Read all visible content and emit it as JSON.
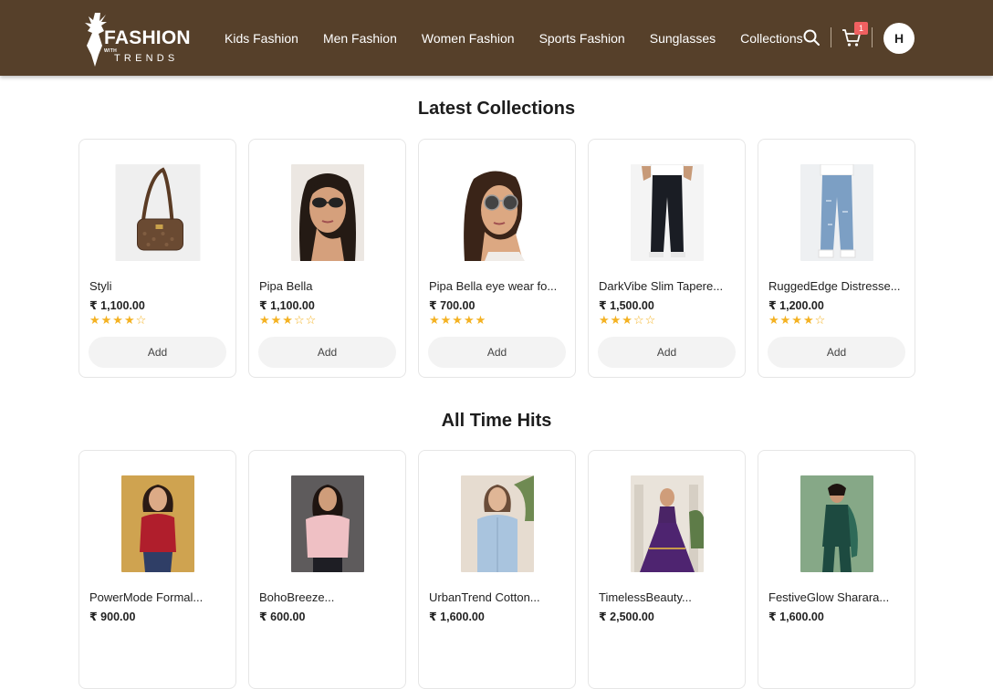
{
  "header": {
    "logo": {
      "title": "FASHION",
      "with": "WITH",
      "subtitle": "TRENDS"
    },
    "nav": [
      {
        "label": "Kids Fashion"
      },
      {
        "label": "Men Fashion"
      },
      {
        "label": "Women Fashion"
      },
      {
        "label": "Sports Fashion"
      },
      {
        "label": "Sunglasses"
      },
      {
        "label": "Collections"
      }
    ],
    "search_icon": "search-icon",
    "cart_icon": "cart-icon",
    "cart_count": "1",
    "avatar_initial": "H",
    "colors": {
      "header_bg": "#56402a",
      "badge": "#f06060",
      "star": "#f4b223"
    }
  },
  "latest": {
    "title": "Latest Collections",
    "products": [
      {
        "name": "Styli",
        "price": "₹ 1,100.00",
        "stars": "★★★★☆",
        "rating": 4,
        "add_label": "Add",
        "image": "brown-handbag"
      },
      {
        "name": "Pipa Bella",
        "price": "₹ 1,100.00",
        "stars": "★★★☆☆",
        "rating": 3,
        "add_label": "Add",
        "image": "woman-sunglasses"
      },
      {
        "name": "Pipa Bella eye wear fo...",
        "price": "₹ 700.00",
        "stars": "★★★★★",
        "rating": 5,
        "add_label": "Add",
        "image": "woman-round-sunglasses"
      },
      {
        "name": "DarkVibe Slim Tapere...",
        "price": "₹ 1,500.00",
        "stars": "★★★☆☆",
        "rating": 3,
        "add_label": "Add",
        "image": "black-jeans"
      },
      {
        "name": "RuggedEdge Distresse...",
        "price": "₹ 1,200.00",
        "stars": "★★★★☆",
        "rating": 4,
        "add_label": "Add",
        "image": "blue-jeans"
      }
    ]
  },
  "hits": {
    "title": "All Time Hits",
    "products": [
      {
        "name": "PowerMode Formal...",
        "price": "₹ 900.00",
        "image": "red-top"
      },
      {
        "name": "BohoBreeze...",
        "price": "₹ 600.00",
        "image": "pink-blouse"
      },
      {
        "name": "UrbanTrend Cotton...",
        "price": "₹ 1,600.00",
        "image": "denim-shirt"
      },
      {
        "name": "TimelessBeauty...",
        "price": "₹ 2,500.00",
        "image": "purple-lehenga"
      },
      {
        "name": "FestiveGlow Sharara...",
        "price": "₹ 1,600.00",
        "image": "green-sharara"
      }
    ]
  }
}
